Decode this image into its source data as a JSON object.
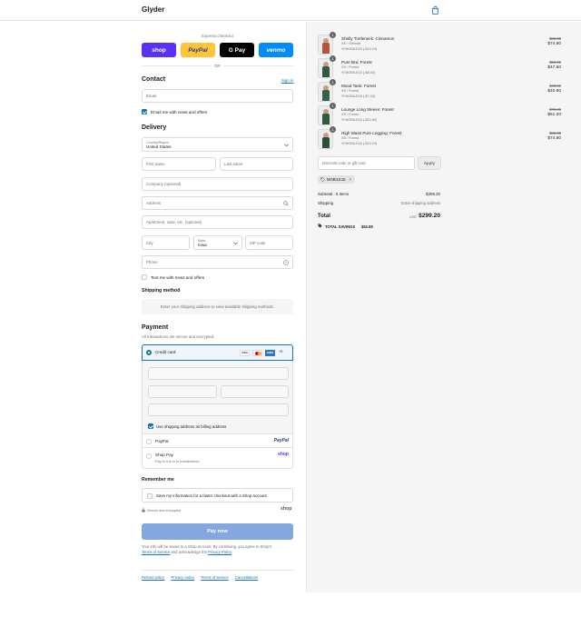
{
  "header": {
    "brand": "Glyder",
    "cart_icon": "shopping-bag-icon"
  },
  "express": {
    "label": "Express checkout",
    "buttons": [
      {
        "label": "shop",
        "color": "#5a31f4",
        "text_color": "#ffffff"
      },
      {
        "label": "PayPal",
        "color": "#ffc439",
        "text_color": "#253b80"
      },
      {
        "label": "G Pay",
        "color": "#000000",
        "text_color": "#ffffff"
      },
      {
        "label": "venmo",
        "color": "#008cff",
        "text_color": "#ffffff"
      }
    ],
    "divider": "OR"
  },
  "contact": {
    "title": "Contact",
    "sign_in": "Sign in",
    "email_placeholder": "Email",
    "news_label": "Email me with news and offers"
  },
  "delivery": {
    "title": "Delivery",
    "country_label": "Country/Region",
    "country_value": "United States",
    "first_name": "First name",
    "last_name": "Last name",
    "company": "Company (optional)",
    "address": "Address",
    "apartment": "Apartment, suite, etc. (optional)",
    "city": "City",
    "state_label": "State",
    "state_value": "Iowa",
    "zip": "ZIP code",
    "phone": "Phone",
    "text_label": "Text me with news and offers"
  },
  "shipping": {
    "title": "Shipping method",
    "message": "Enter your shipping address to view available shipping methods."
  },
  "payment": {
    "title": "Payment",
    "subtitle": "All transactions are secure and encrypted.",
    "credit_card": "Credit card",
    "card_brands": [
      "VISA",
      "MC",
      "AMEX",
      "+5"
    ],
    "billing_label": "Use shipping address as billing address",
    "paypal": "PayPal",
    "paypal_logo": "PayPal",
    "shop_pay": "Shop Pay",
    "shop_pay_sub": "Pay in full or in installments",
    "shop_logo": "shop"
  },
  "remember": {
    "title": "Remember me",
    "label": "Save my information for a faster checkout with a Shop account",
    "secure": "Secure and encrypted",
    "shop_logo": "shop"
  },
  "pay_button": "Pay now",
  "legal": {
    "line1": "Your info will be saved to a Shop account. By continuing, you agree to Shop's",
    "terms": "Terms of Service",
    "middle": "and acknowledge the",
    "privacy": "Privacy Policy",
    "end": "."
  },
  "footer": [
    "Refund policy",
    "Privacy policy",
    "Terms of service",
    "Cancellations"
  ],
  "summary": {
    "items": [
      {
        "qty": "1",
        "name": "Shelly Turtleneck: Cinnamon",
        "variant": "XS / Gelinde",
        "discount": "MOBILE15 (-$13.20)",
        "original": "$88.00",
        "price": "$74.80",
        "color": "#b5553a"
      },
      {
        "qty": "1",
        "name": "Pure Bra: Forest",
        "variant": "XS / Forest",
        "discount": "MOBILE15 (-$8.40)",
        "original": "$56.00",
        "price": "$47.60",
        "color": "#2f5a40"
      },
      {
        "qty": "1",
        "name": "Mood Tank: Forest",
        "variant": "XS / Forest",
        "discount": "MOBILE15 (-$7.20)",
        "original": "$48.00",
        "price": "$40.80",
        "color": "#36614a"
      },
      {
        "qty": "1",
        "name": "Lounge Long Sleeve: Forest",
        "variant": "XS / Forest",
        "discount": "MOBILE15 (-$10.80)",
        "original": "$72.00",
        "price": "$61.20",
        "color": "#2b5a3f"
      },
      {
        "qty": "1",
        "name": "High Waist Pure Legging: Forest",
        "variant": "XS / Forest",
        "discount": "MOBILE15 (-$13.20)",
        "original": "$88.00",
        "price": "$74.80",
        "color": "#2e4f3c"
      }
    ],
    "discount_placeholder": "Discount code or gift card",
    "apply": "Apply",
    "code": "MOBILE15",
    "subtotal_label": "Subtotal · 5 items",
    "subtotal": "$299.20",
    "shipping_label": "Shipping",
    "shipping_value": "Enter shipping address",
    "total_label": "Total",
    "currency": "USD",
    "total": "$299.20",
    "savings_label": "TOTAL SAVINGS",
    "savings": "$52.80"
  }
}
